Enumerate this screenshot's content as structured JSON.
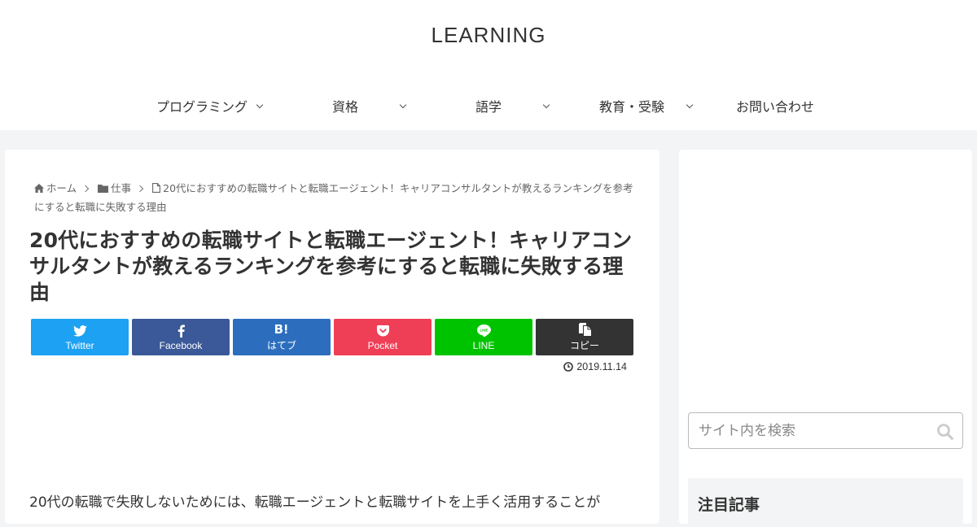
{
  "header": {
    "site_title": "LEARNING",
    "nav": [
      {
        "label": "プログラミング",
        "has_submenu": true
      },
      {
        "label": "資格",
        "has_submenu": true
      },
      {
        "label": "語学",
        "has_submenu": true
      },
      {
        "label": "教育・受験",
        "has_submenu": true
      },
      {
        "label": "お問い合わせ",
        "has_submenu": false
      }
    ]
  },
  "breadcrumb": {
    "home": "ホーム",
    "category": "仕事",
    "current": "20代におすすめの転職サイトと転職エージェント！キャリアコンサルタントが教えるランキングを参考にすると転職に失敗する理由"
  },
  "article": {
    "title": "20代におすすめの転職サイトと転職エージェント！キャリアコンサルタントが教えるランキングを参考にすると転職に失敗する理由",
    "date": "2019.11.14",
    "lead": "20代の転職で失敗しないためには、転職エージェントと転職サイトを上手く活用することが"
  },
  "share": [
    {
      "label": "Twitter",
      "icon": "twitter-icon",
      "color": "#1da1f2"
    },
    {
      "label": "Facebook",
      "icon": "facebook-icon",
      "color": "#3b5998"
    },
    {
      "label": "はてブ",
      "icon": "hatena-bookmark-icon",
      "color": "#2c6ebd"
    },
    {
      "label": "Pocket",
      "icon": "pocket-icon",
      "color": "#ef3f56"
    },
    {
      "label": "LINE",
      "icon": "line-icon",
      "color": "#00c300"
    },
    {
      "label": "コピー",
      "icon": "copy-icon",
      "color": "#333333"
    }
  ],
  "sidebar": {
    "search_placeholder": "サイト内を検索",
    "widget_title": "注目記事"
  }
}
